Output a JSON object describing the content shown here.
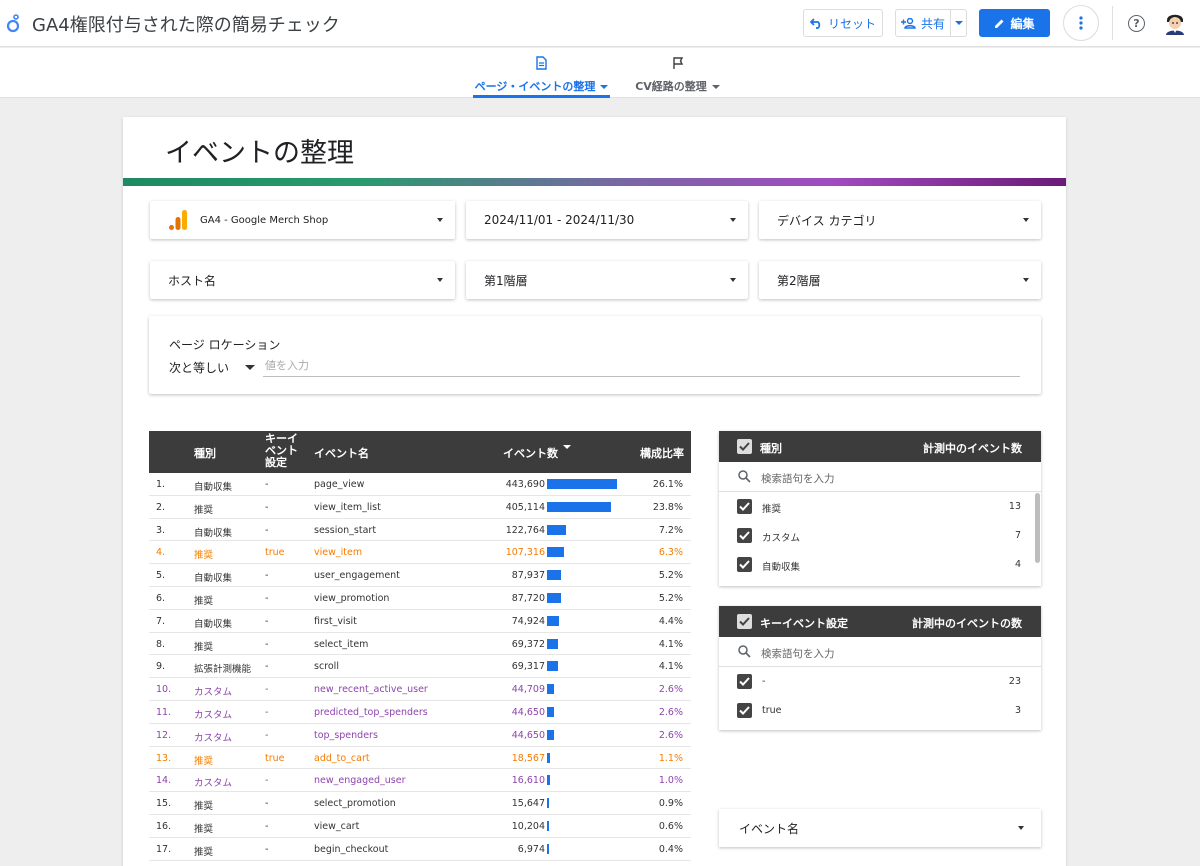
{
  "header": {
    "title": "GA4権限付与された際の簡易チェック",
    "reset_label": "リセット",
    "share_label": "共有",
    "edit_label": "編集",
    "help_label": "?"
  },
  "nav": {
    "tabs": [
      {
        "label": "ページ・イベントの整理",
        "active": true
      },
      {
        "label": "CV経路の整理",
        "active": false
      }
    ]
  },
  "page": {
    "heading": "イベントの整理"
  },
  "controls": {
    "property": "GA4 - Google Merch Shop",
    "date_range": "2024/11/01 - 2024/11/30",
    "device_category": "デバイス カテゴリ",
    "host_name": "ホスト名",
    "level1": "第1階層",
    "level2": "第2階層"
  },
  "page_location": {
    "title": "ページ ロケーション",
    "operator": "次と等しい",
    "placeholder": "値を入力"
  },
  "table": {
    "headers": {
      "type": "種別",
      "key_event": "キーイベント設定",
      "event_name": "イベント名",
      "event_count": "イベント数",
      "ratio": "構成比率"
    },
    "rows": [
      {
        "no": "1.",
        "type": "自動収集",
        "key": "-",
        "name": "page_view",
        "count": "443,690",
        "count_value": 443690,
        "ratio": "26.1%",
        "style": "normal"
      },
      {
        "no": "2.",
        "type": "推奨",
        "key": "-",
        "name": "view_item_list",
        "count": "405,114",
        "count_value": 405114,
        "ratio": "23.8%",
        "style": "normal"
      },
      {
        "no": "3.",
        "type": "自動収集",
        "key": "-",
        "name": "session_start",
        "count": "122,764",
        "count_value": 122764,
        "ratio": "7.2%",
        "style": "normal"
      },
      {
        "no": "4.",
        "type": "推奨",
        "key": "true",
        "name": "view_item",
        "count": "107,316",
        "count_value": 107316,
        "ratio": "6.3%",
        "style": "orange"
      },
      {
        "no": "5.",
        "type": "自動収集",
        "key": "-",
        "name": "user_engagement",
        "count": "87,937",
        "count_value": 87937,
        "ratio": "5.2%",
        "style": "normal"
      },
      {
        "no": "6.",
        "type": "推奨",
        "key": "-",
        "name": "view_promotion",
        "count": "87,720",
        "count_value": 87720,
        "ratio": "5.2%",
        "style": "normal"
      },
      {
        "no": "7.",
        "type": "自動収集",
        "key": "-",
        "name": "first_visit",
        "count": "74,924",
        "count_value": 74924,
        "ratio": "4.4%",
        "style": "normal"
      },
      {
        "no": "8.",
        "type": "推奨",
        "key": "-",
        "name": "select_item",
        "count": "69,372",
        "count_value": 69372,
        "ratio": "4.1%",
        "style": "normal"
      },
      {
        "no": "9.",
        "type": "拡張計測機能",
        "key": "-",
        "name": "scroll",
        "count": "69,317",
        "count_value": 69317,
        "ratio": "4.1%",
        "style": "normal"
      },
      {
        "no": "10.",
        "type": "カスタム",
        "key": "-",
        "name": "new_recent_active_user",
        "count": "44,709",
        "count_value": 44709,
        "ratio": "2.6%",
        "style": "purple"
      },
      {
        "no": "11.",
        "type": "カスタム",
        "key": "-",
        "name": "predicted_top_spenders",
        "count": "44,650",
        "count_value": 44650,
        "ratio": "2.6%",
        "style": "purple"
      },
      {
        "no": "12.",
        "type": "カスタム",
        "key": "-",
        "name": "top_spenders",
        "count": "44,650",
        "count_value": 44650,
        "ratio": "2.6%",
        "style": "purple"
      },
      {
        "no": "13.",
        "type": "推奨",
        "key": "true",
        "name": "add_to_cart",
        "count": "18,567",
        "count_value": 18567,
        "ratio": "1.1%",
        "style": "orange"
      },
      {
        "no": "14.",
        "type": "カスタム",
        "key": "-",
        "name": "new_engaged_user",
        "count": "16,610",
        "count_value": 16610,
        "ratio": "1.0%",
        "style": "purple"
      },
      {
        "no": "15.",
        "type": "推奨",
        "key": "-",
        "name": "select_promotion",
        "count": "15,647",
        "count_value": 15647,
        "ratio": "0.9%",
        "style": "normal"
      },
      {
        "no": "16.",
        "type": "推奨",
        "key": "-",
        "name": "view_cart",
        "count": "10,204",
        "count_value": 10204,
        "ratio": "0.6%",
        "style": "normal"
      },
      {
        "no": "17.",
        "type": "推奨",
        "key": "-",
        "name": "begin_checkout",
        "count": "6,974",
        "count_value": 6974,
        "ratio": "0.4%",
        "style": "normal"
      }
    ]
  },
  "type_filter": {
    "header": "種別",
    "count_header": "計測中のイベント数",
    "search_placeholder": "検索語句を入力",
    "items": [
      {
        "label": "推奨",
        "count": "13"
      },
      {
        "label": "カスタム",
        "count": "7"
      },
      {
        "label": "自動収集",
        "count": "4"
      }
    ]
  },
  "key_filter": {
    "header": "キーイベント設定",
    "count_header": "計測中のイベントの数",
    "search_placeholder": "検索語句を入力",
    "items": [
      {
        "label": "-",
        "count": "23"
      },
      {
        "label": "true",
        "count": "3"
      }
    ]
  },
  "event_name_control": {
    "label": "イベント名"
  },
  "colors": {
    "accent": "#1a73e8",
    "key_event_row": "#f57c00",
    "custom_row": "#8e44ad",
    "table_header": "#3c3c3c"
  }
}
